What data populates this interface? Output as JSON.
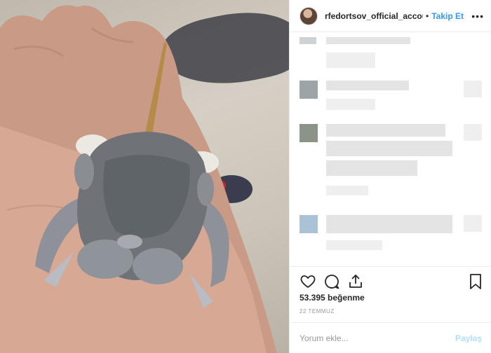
{
  "post": {
    "image_alt": "",
    "header": {
      "username": "rfedortsov_official_accou",
      "separator": "•",
      "follow_label": "Takip Et",
      "more_icon": "more-horizontal-icon",
      "more_glyph": "•••"
    },
    "actions": {
      "like_icon": "heart-icon",
      "comment_icon": "comment-icon",
      "share_icon": "share-icon",
      "save_icon": "bookmark-icon"
    },
    "likes_text": "53.395 beğenme",
    "date_text": "22 TEMMUZ",
    "comment_input": {
      "placeholder": "Yorum ekle...",
      "value": ""
    },
    "post_label": "Paylaş",
    "colors": {
      "link": "#3897f0",
      "post_disabled": "#b2dffc",
      "muted": "#999999",
      "text": "#262626"
    }
  }
}
